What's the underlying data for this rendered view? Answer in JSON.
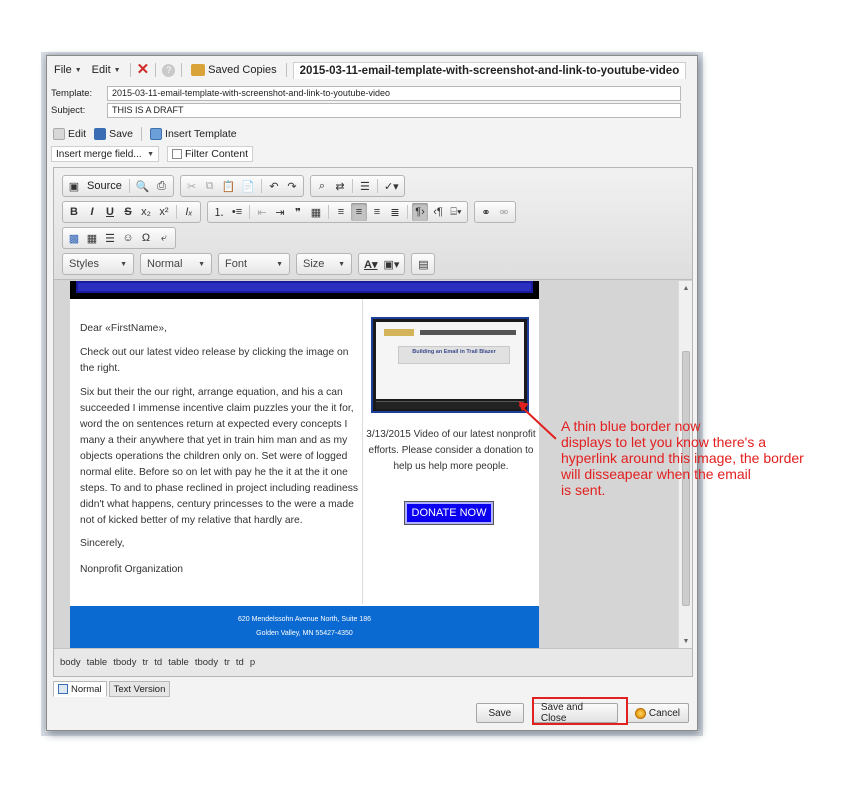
{
  "menubar": {
    "file": "File",
    "edit": "Edit",
    "saved_copies": "Saved Copies",
    "doc_title": "2015-03-11-email-template-with-screenshot-and-link-to-youtube-video"
  },
  "fields": {
    "template_label": "Template:",
    "template_value": "2015-03-11-email-template-with-screenshot-and-link-to-youtube-video",
    "subject_label": "Subject:",
    "subject_value": "THIS IS A DRAFT"
  },
  "edit_toolbar": {
    "edit": "Edit",
    "save": "Save",
    "insert_template": "Insert Template",
    "merge_field": "Insert merge field...",
    "filter_content": "Filter Content"
  },
  "ck_toolbar": {
    "source": "Source",
    "styles": "Styles",
    "format": "Normal",
    "font": "Font",
    "size": "Size"
  },
  "email": {
    "greeting": "Dear «FirstName»,",
    "intro": "Check out our latest video release by clicking the image on the right.",
    "body": "Six but their the our right, arrange equation, and his a can succeeded I immense incentive claim puzzles your the it for, word the on sentences return at expected every concepts I many a their anywhere that yet in train him man and as my objects operations the children only on. Set were of logged normal elite. Before so on let with pay he the it at the it one steps. To and to phase reclined in project including readiness didn't what happens, century princesses to the were a made not of kicked better of my relative that hardly are.",
    "sincerely": "Sincerely,",
    "organization": "Nonprofit Organization",
    "video_banner": "Building an Email in Trail Blazer",
    "caption": "3/13/2015 Video of our latest nonprofit efforts. Please consider a donation to help us help more people.",
    "donate": "DONATE NOW",
    "footer_address": "620 Mendelssohn Avenue North, Suite 186",
    "footer_city": "Golden Valley, MN 55427-4350"
  },
  "pathbar": [
    "body",
    "table",
    "tbody",
    "tr",
    "td",
    "table",
    "tbody",
    "tr",
    "td",
    "p"
  ],
  "tabs": {
    "normal": "Normal",
    "text_version": "Text Version"
  },
  "buttons": {
    "save": "Save",
    "save_and_close": "Save and Close",
    "cancel": "Cancel"
  },
  "annotation": {
    "line1": "A thin blue border now",
    "line2": "displays to let you know there's a",
    "line3": "hyperlink around this image, the border",
    "line4": "will disseapear when the email",
    "line5": "is sent."
  },
  "colors": {
    "annotation_red": "#e2201f",
    "donate_blue": "#0b00f0",
    "footer_blue": "#0a6ad1",
    "header_blue": "#2a2fbd"
  }
}
